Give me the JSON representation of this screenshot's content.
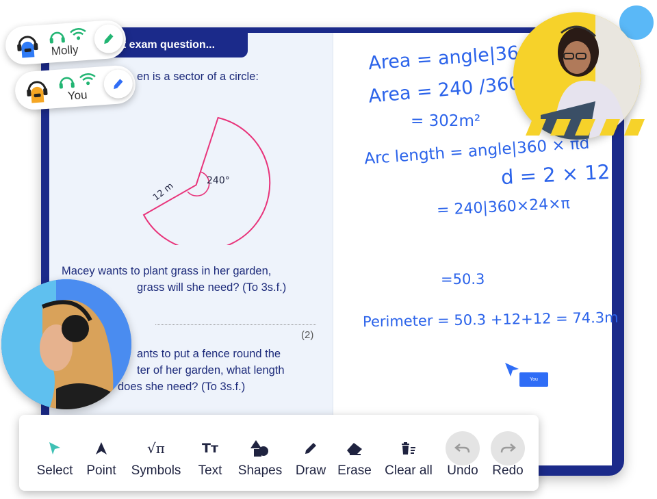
{
  "question": {
    "tab_title": "st exam question...",
    "intro": "en is a sector of a circle:",
    "radius_label": "12 m",
    "angle_label": "240°",
    "part_a_line1": "Macey wants to plant grass in her garden,",
    "part_a_line2": "grass will she need? (To 3s.f.)",
    "marks": "(2)",
    "part_b_line1": "ants to put a fence round the",
    "part_b_line2": "ter of her garden, what length",
    "part_b_line3": "does she need? (To 3s.f.)"
  },
  "users": [
    {
      "name": "Molly",
      "avatar_color": "#2f7bf6"
    },
    {
      "name": "You",
      "avatar_color": "#f5a623"
    }
  ],
  "whiteboard": {
    "ink_color": "#2b63ea",
    "lines": [
      "Area = angle|360 ×",
      "Area = 240 /360 ×π",
      "= 302m²",
      "Arc length = angle|360 × πd",
      "d = 2 × 12",
      "= 240|360×24×π",
      "=50.3",
      "Perimeter = 50.3 +12+12 = 74.3m"
    ],
    "cursor_label": "You"
  },
  "toolbar": {
    "tools": [
      {
        "label": "Select",
        "icon": "select-arrow-icon"
      },
      {
        "label": "Point",
        "icon": "point-arrow-icon"
      },
      {
        "label": "Symbols",
        "icon": "symbols-icon",
        "glyph": "√π"
      },
      {
        "label": "Text",
        "icon": "text-icon",
        "glyph": "Tт"
      },
      {
        "label": "Shapes",
        "icon": "shapes-icon"
      },
      {
        "label": "Draw",
        "icon": "pencil-icon"
      },
      {
        "label": "Erase",
        "icon": "eraser-icon"
      },
      {
        "label": "Clear all",
        "icon": "clear-all-icon"
      },
      {
        "label": "Undo",
        "icon": "undo-icon"
      },
      {
        "label": "Redo",
        "icon": "redo-icon"
      }
    ]
  },
  "colors": {
    "frame": "#1b2a8a",
    "question_text": "#1c2a7a",
    "sector_stroke": "#e8337a",
    "status_green": "#22b573",
    "accent_blue": "#2f6df6",
    "select_teal": "#3fc1b5"
  }
}
